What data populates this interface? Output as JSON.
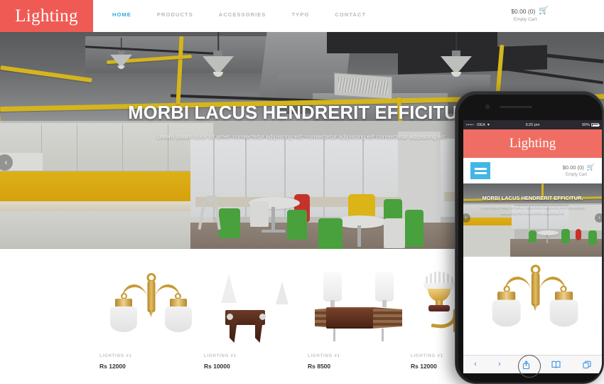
{
  "site": {
    "brand": "Lighting",
    "nav": [
      {
        "label": "HOME",
        "active": true
      },
      {
        "label": "PRODUCTS",
        "active": false
      },
      {
        "label": "ACCESSORIES",
        "active": false
      },
      {
        "label": "TYPO",
        "active": false
      },
      {
        "label": "CONTACT",
        "active": false
      }
    ],
    "cart": {
      "price": "$0.00 (0)",
      "status": "Empty Cart",
      "icon": "shopping-cart-icon"
    }
  },
  "hero": {
    "title": "MORBI LACUS HENDRERIT EFFICITUR.",
    "subtitle": "Lorem ipsum dolor sit amet, consectetur adipiscing elit. consectetur adipiscing elit consectetur adipiscing elit.",
    "prev_arrow": "‹",
    "next_arrow": "›"
  },
  "products": [
    {
      "name": "LIGHTING #1",
      "price": "Rs 12000",
      "art": "brass-double-sconce"
    },
    {
      "name": "LIGHTING #1",
      "price": "Rs 10000",
      "art": "wood-double-sconce"
    },
    {
      "name": "LIGHTING #1",
      "price": "Rs 8500",
      "art": "cylinder-double-sconce"
    },
    {
      "name": "LIGHTING #1",
      "price": "Rs 12000",
      "art": "ornate-brass-sconce"
    }
  ],
  "phone": {
    "status_bar": {
      "signal_dots": "••••◦",
      "carrier": "IDEA",
      "wifi": "wifi-icon",
      "time": "9:20 pm",
      "battery_percent": "90%"
    },
    "brand": "Lighting",
    "menu_icon": "hamburger-menu-icon",
    "cart": {
      "price": "$0.00 (0)",
      "status": "Empty Cart",
      "icon": "shopping-cart-icon"
    },
    "hero": {
      "title": "MORBI LACUS HENDRERIT EFFICITUR.",
      "subtitle": "Lorem ipsum dolor sit amet, consectetur adipiscing elit consectetur adipiscing elit consectetur adipiscing elit",
      "prev_arrow": "‹",
      "next_arrow": "›"
    },
    "toolbar": [
      {
        "icon": "back-chevron-icon",
        "glyph": "‹"
      },
      {
        "icon": "forward-chevron-icon",
        "glyph": "›"
      },
      {
        "icon": "share-icon",
        "glyph": "⇧"
      },
      {
        "icon": "bookmarks-book-icon",
        "glyph": "□"
      },
      {
        "icon": "tabs-icon",
        "glyph": "⧉"
      }
    ]
  },
  "colors": {
    "brand_red": "#ef5b54",
    "phone_brand_red": "#ef6d63",
    "active_nav_blue": "#29abe2",
    "mobile_menu_blue": "#44b6e5",
    "toolbar_blue": "#3b8fe8",
    "accent_yellow": "#eaaf0c"
  }
}
